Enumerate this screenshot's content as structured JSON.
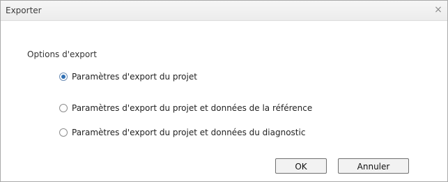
{
  "window": {
    "title": "Exporter",
    "close_glyph": "×"
  },
  "options": {
    "group_label": "Options d'export",
    "items": [
      {
        "label": "Paramètres d'export du projet",
        "selected": true
      },
      {
        "label": "Paramètres d'export du projet et données de la référence",
        "selected": false
      },
      {
        "label": "Paramètres d'export du projet et données du diagnostic",
        "selected": false
      }
    ]
  },
  "buttons": {
    "ok_label": "OK",
    "cancel_label": "Annuler"
  },
  "icons": {
    "close": "close-icon",
    "radio_selected": "radio-selected-icon",
    "radio_unselected": "radio-unselected-icon"
  }
}
